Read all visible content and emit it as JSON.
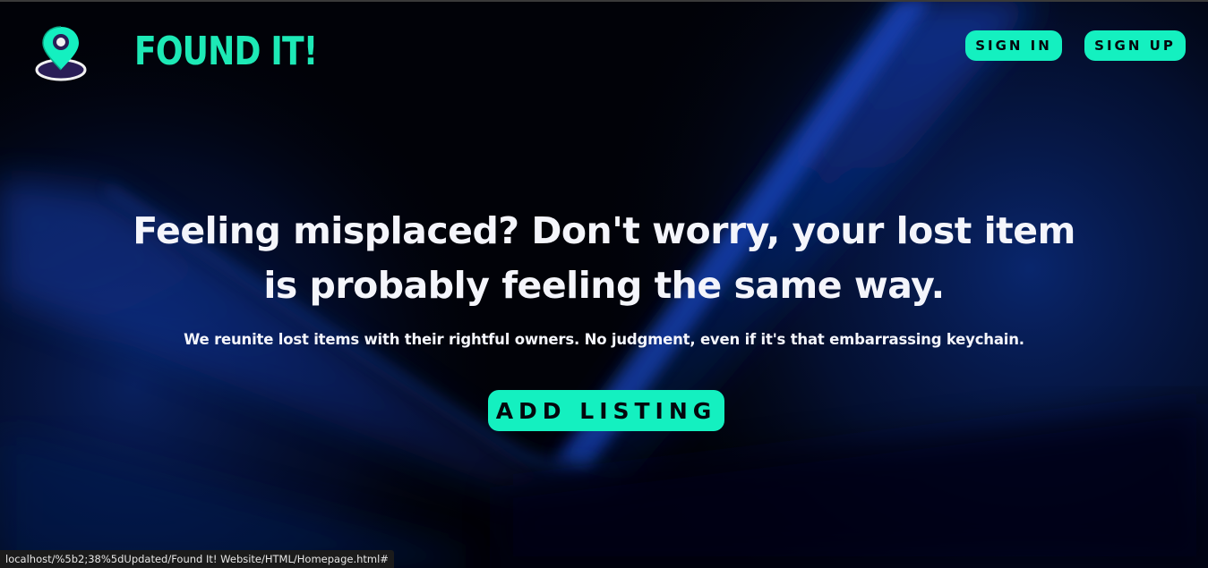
{
  "brand": {
    "name": "FOUND IT!",
    "logo_icon": "map-pin-icon",
    "accent_color": "#14f0c0"
  },
  "nav": {
    "sign_in_label": "SIGN IN",
    "sign_up_label": "SIGN UP"
  },
  "hero": {
    "headline": "Feeling misplaced? Don't worry, your lost item is probably feeling the same way.",
    "subheadline": "We reunite lost items with their rightful owners. No judgment, even if it's that embarrassing keychain.",
    "cta_label": "ADD LISTING"
  },
  "status_bar": {
    "url": "localhost/%5b2;38%5dUpdated/Found It! Website/HTML/Homepage.html#"
  }
}
